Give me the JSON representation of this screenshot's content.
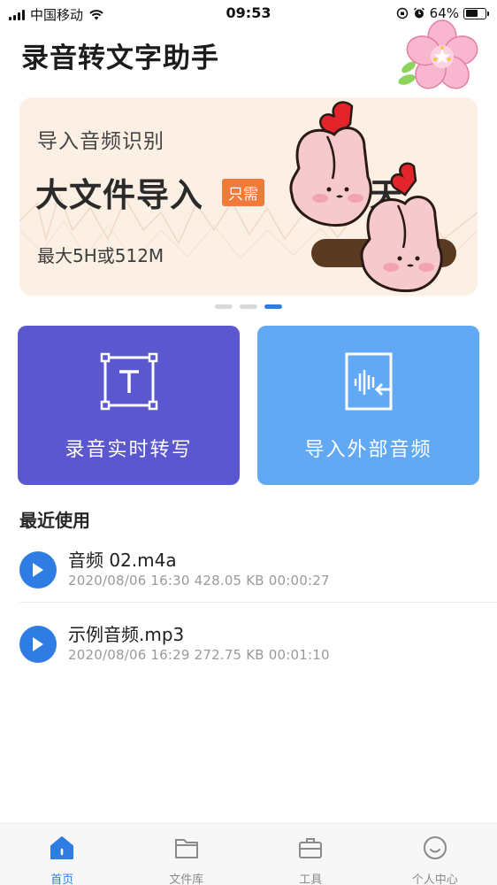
{
  "status_bar": {
    "carrier": "中国移动",
    "time": "09:53",
    "battery_percent": "64%",
    "battery_level": 0.64
  },
  "header": {
    "title": "录音转文字助手"
  },
  "banner": {
    "subtitle": "导入音频识别",
    "headline": "大文件导入",
    "tag": "只需",
    "days_text": "天",
    "limit_text": "最大5H或512M",
    "page_count": 3,
    "active_page": 2
  },
  "actions": {
    "record_label": "录音实时转写",
    "import_label": "导入外部音频"
  },
  "recent": {
    "title": "最近使用",
    "items": [
      {
        "name": "音频 02.m4a",
        "meta": "2020/08/06 16:30  428.05 KB  00:00:27"
      },
      {
        "name": "示例音频.mp3",
        "meta": "2020/08/06 16:29  272.75 KB  00:01:10"
      }
    ]
  },
  "tabs": [
    {
      "label": "首页",
      "icon": "home-icon",
      "active": true
    },
    {
      "label": "文件库",
      "icon": "folder-icon",
      "active": false
    },
    {
      "label": "工具",
      "icon": "toolbox-icon",
      "active": false
    },
    {
      "label": "个人中心",
      "icon": "profile-icon",
      "active": false
    }
  ],
  "colors": {
    "accent": "#2f7de3",
    "record_card": "#5b57cf",
    "import_card": "#62a9f3",
    "banner_bg": "#fcefe4",
    "tag_orange": "#ef7a3a"
  }
}
